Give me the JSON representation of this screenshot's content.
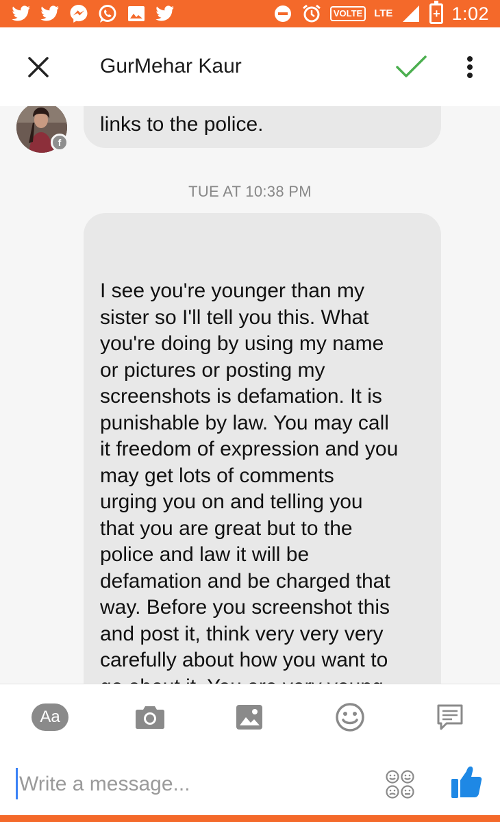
{
  "status_bar": {
    "notification_icons": [
      "twitter-icon",
      "twitter-icon",
      "messenger-icon",
      "whatsapp-icon",
      "gallery-icon",
      "twitter-icon"
    ],
    "volte_label": "VOLTE",
    "network_label": "LTE",
    "battery_label": "+",
    "time": "1:02",
    "accent_color": "#f4692a"
  },
  "header": {
    "contact_name": "GurMehar Kaur"
  },
  "conversation": {
    "previous_message_tail": "links to the police.",
    "timestamp": "TUE AT 10:38 PM",
    "main_message": "I see you're younger than my\nsister so I'll tell you this. What\nyou're doing by using my name\nor pictures or posting my\nscreenshots is defamation. It is\npunishable by law. You may call\nit freedom of expression and you\nmay get lots of comments\nurging you on and telling you\nthat you are great but to the\npolice and law it will be\ndefamation and be charged that\nway. Before you screenshot this\nand post it, think very very very\ncarefully about how you want to\ngo about it. You are very young\nand I understand where you\nmight be coming from but your"
  },
  "composer": {
    "aa_label": "Aa",
    "placeholder": "Write a message...",
    "like_color": "#1e88e5"
  }
}
